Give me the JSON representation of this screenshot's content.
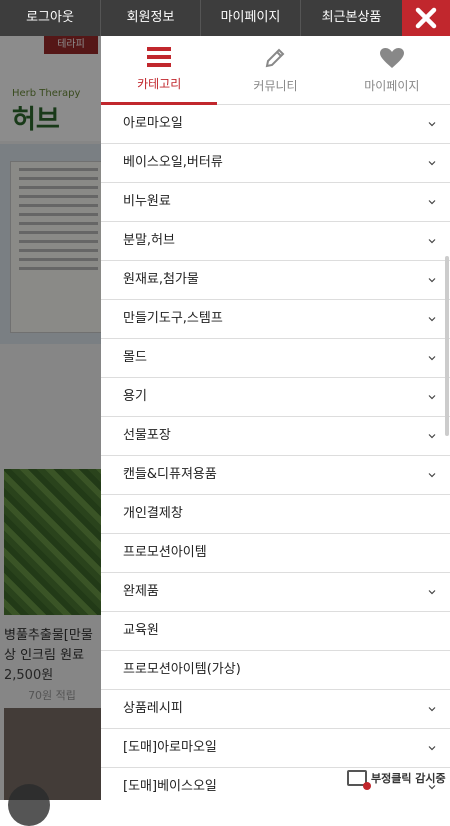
{
  "topbar": {
    "items": [
      {
        "label": "로그아웃"
      },
      {
        "label": "회원정보"
      },
      {
        "label": "마이페이지"
      },
      {
        "label": "최근본상품"
      }
    ],
    "close_icon": "close-x-icon",
    "bg_color": "#3d3d3d",
    "close_color": "#c1272d"
  },
  "background_page": {
    "logo_small": "테라피",
    "logo_main": "허브",
    "logo_tag": "Herb Therapy",
    "product_name": "병풀추출물[만물상 인크림 원료",
    "product_price": "2,500원",
    "product_points": "70원 적립"
  },
  "tabs": [
    {
      "label": "카테고리",
      "icon": "hamburger-icon",
      "active": true
    },
    {
      "label": "커뮤니티",
      "icon": "pencil-icon",
      "active": false
    },
    {
      "label": "마이페이지",
      "icon": "heart-icon",
      "active": false
    }
  ],
  "menu": {
    "items": [
      {
        "label": "아로마오일",
        "expandable": true
      },
      {
        "label": "베이스오일,버터류",
        "expandable": true
      },
      {
        "label": "비누원료",
        "expandable": true
      },
      {
        "label": "분말,허브",
        "expandable": true
      },
      {
        "label": "원재료,첨가물",
        "expandable": true
      },
      {
        "label": "만들기도구,스템프",
        "expandable": true
      },
      {
        "label": "몰드",
        "expandable": true
      },
      {
        "label": "용기",
        "expandable": true
      },
      {
        "label": "선물포장",
        "expandable": true
      },
      {
        "label": "캔들&디퓨져용품",
        "expandable": true
      },
      {
        "label": "개인결제창",
        "expandable": false
      },
      {
        "label": "프로모션아이템",
        "expandable": false
      },
      {
        "label": "완제품",
        "expandable": true
      },
      {
        "label": "교육원",
        "expandable": false
      },
      {
        "label": "프로모션아이템(가상)",
        "expandable": false
      },
      {
        "label": "상품레시피",
        "expandable": true
      },
      {
        "label": "[도매]아로마오일",
        "expandable": true
      },
      {
        "label": "[도매]베이스오일",
        "expandable": true
      }
    ]
  },
  "fraud_badge": {
    "label": "부정클릭 감시중"
  },
  "accent_color": "#c1272d"
}
